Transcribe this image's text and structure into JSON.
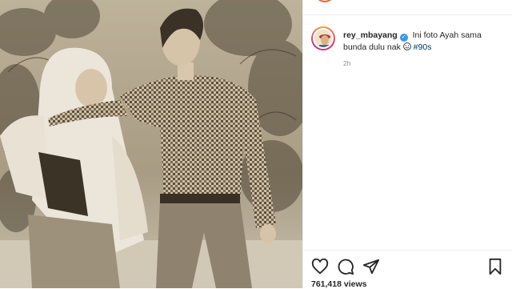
{
  "post": {
    "username": "rey_mbayang",
    "caption_text": "Ini foto Ayah sama bunda dulu nak",
    "hashtag": "#90s",
    "timestamp": "2h",
    "views": "761,418 views"
  },
  "icons": {
    "verified": "verified-badge-icon",
    "emoji": "smiling-face-emoji",
    "like": "heart-icon",
    "comment": "comment-icon",
    "share": "paper-plane-icon",
    "save": "bookmark-icon"
  },
  "colors": {
    "text": "#262626",
    "muted": "#8e8e8e",
    "hashtag": "#00376b",
    "verified": "#3897f0",
    "photo_tone": "#c9bea8"
  }
}
